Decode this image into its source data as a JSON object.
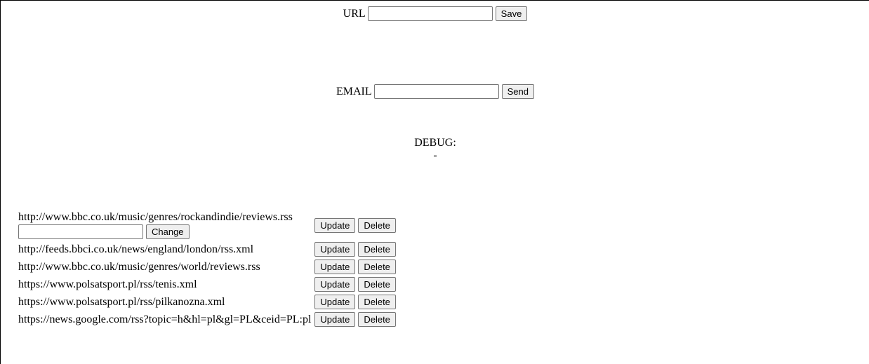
{
  "url_form": {
    "label": "URL",
    "value": "",
    "save_label": "Save"
  },
  "email_form": {
    "label": "EMAIL",
    "value": "",
    "send_label": "Send"
  },
  "debug": {
    "label": "DEBUG:",
    "value": "-"
  },
  "feeds": [
    {
      "url": "http://www.bbc.co.uk/music/genres/rockandindie/reviews.rss",
      "edit_value": "",
      "change_label": "Change",
      "update_label": "Update",
      "delete_label": "Delete"
    },
    {
      "url": "http://feeds.bbci.co.uk/news/england/london/rss.xml",
      "update_label": "Update",
      "delete_label": "Delete"
    },
    {
      "url": "http://www.bbc.co.uk/music/genres/world/reviews.rss",
      "update_label": "Update",
      "delete_label": "Delete"
    },
    {
      "url": "https://www.polsatsport.pl/rss/tenis.xml",
      "update_label": "Update",
      "delete_label": "Delete"
    },
    {
      "url": "https://www.polsatsport.pl/rss/pilkanozna.xml",
      "update_label": "Update",
      "delete_label": "Delete"
    },
    {
      "url": "https://news.google.com/rss?topic=h&hl=pl&gl=PL&ceid=PL:pl",
      "update_label": "Update",
      "delete_label": "Delete"
    }
  ]
}
